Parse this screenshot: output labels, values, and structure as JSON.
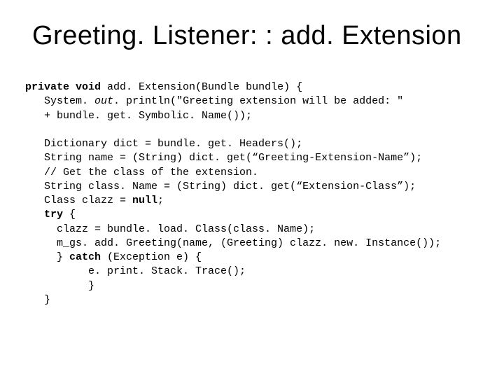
{
  "title": "Greeting. Listener: : add. Extension",
  "code": {
    "l01a": "private void",
    "l01b": " add. Extension(Bundle bundle) {",
    "l02a": "   System. ",
    "l02b": "out",
    "l02c": ". println(\"Greeting extension will be added: \"",
    "l03": "   + bundle. get. Symbolic. Name());",
    "blank1": "",
    "l04": "   Dictionary dict = bundle. get. Headers();",
    "l05": "   String name = (String) dict. get(“Greeting-Extension-Name”);",
    "l06": "   // Get the class of the extension.",
    "l07": "   String class. Name = (String) dict. get(“Extension-Class”);",
    "l08a": "   Class clazz = ",
    "l08b": "null",
    "l08c": ";",
    "l09a": "   ",
    "l09b": "try",
    "l09c": " {",
    "l10": "     clazz = bundle. load. Class(class. Name);",
    "l11": "     m_gs. add. Greeting(name, (Greeting) clazz. new. Instance());",
    "l12a": "     } ",
    "l12b": "catch",
    "l12c": " (Exception e) {",
    "l13": "          e. print. Stack. Trace();",
    "l14": "          }",
    "l15": "   }"
  }
}
